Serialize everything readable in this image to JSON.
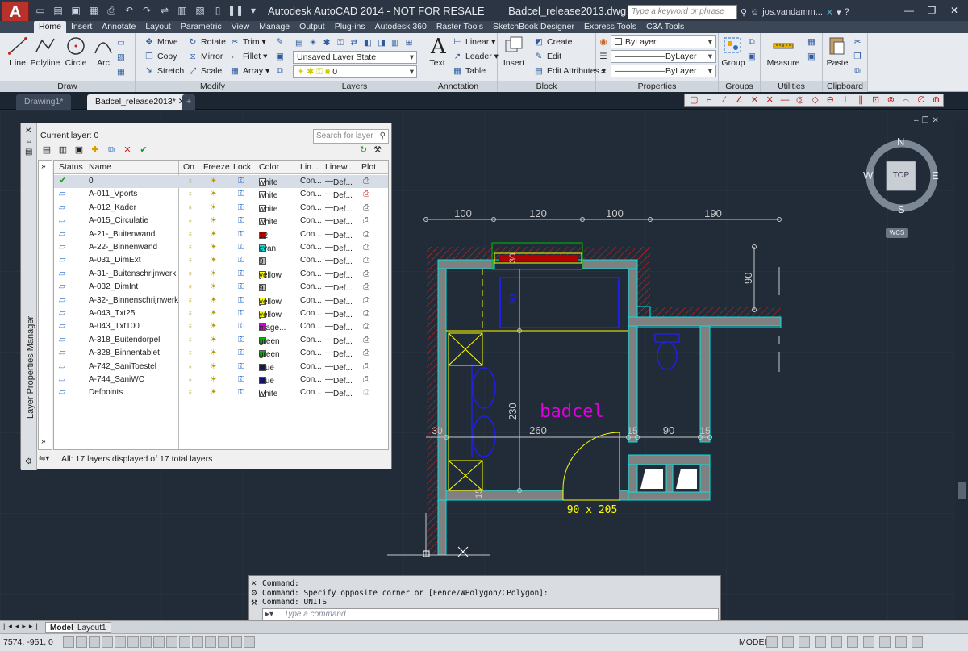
{
  "app": {
    "logo": "A",
    "title": "Autodesk AutoCAD 2014 - NOT FOR RESALE",
    "filename": "Badcel_release2013.dwg",
    "search_placeholder": "Type a keyword or phrase",
    "user": "jos.vandamm..."
  },
  "ribbon_tabs": [
    "Home",
    "Insert",
    "Annotate",
    "Layout",
    "Parametric",
    "View",
    "Manage",
    "Output",
    "Plug-ins",
    "Autodesk 360",
    "Raster Tools",
    "SketchBook Designer",
    "Express Tools",
    "C3A Tools"
  ],
  "ribbon": {
    "draw": {
      "title": "Draw",
      "line": "Line",
      "polyline": "Polyline",
      "circle": "Circle",
      "arc": "Arc"
    },
    "modify": {
      "title": "Modify",
      "move": "Move",
      "rotate": "Rotate",
      "trim": "Trim",
      "copy": "Copy",
      "mirror": "Mirror",
      "fillet": "Fillet",
      "stretch": "Stretch",
      "scale": "Scale",
      "array": "Array"
    },
    "layers": {
      "title": "Layers",
      "state": "Unsaved Layer State",
      "current": "0"
    },
    "annotation": {
      "title": "Annotation",
      "text": "Text",
      "linear": "Linear",
      "leader": "Leader",
      "table": "Table"
    },
    "block": {
      "title": "Block",
      "insert": "Insert",
      "create": "Create",
      "edit": "Edit",
      "edit_attributes": "Edit Attributes"
    },
    "properties": {
      "title": "Properties",
      "color": "ByLayer",
      "linetype": "ByLayer",
      "lineweight": "ByLayer"
    },
    "groups": {
      "title": "Groups",
      "group": "Group"
    },
    "utilities": {
      "title": "Utilities",
      "measure": "Measure"
    },
    "clipboard": {
      "title": "Clipboard",
      "paste": "Paste"
    }
  },
  "doc_tabs": [
    "Drawing1*",
    "Badcel_release2013*"
  ],
  "layer_manager": {
    "title": "Layer Properties Manager",
    "current_layer": "Current layer: 0",
    "search_placeholder": "Search for layer",
    "columns": [
      "Status",
      "Name",
      "On",
      "Freeze",
      "Lock",
      "Color",
      "Lin...",
      "Linew...",
      "Plot"
    ],
    "status_text": "All: 17 layers displayed of 17 total layers",
    "layers": [
      {
        "name": "0",
        "color": "white",
        "swatch": "#ffffff",
        "linetype": "Con...",
        "lineweight": "Def..."
      },
      {
        "name": "A-011_Vports",
        "color": "white",
        "swatch": "#ffffff",
        "linetype": "Con...",
        "lineweight": "Def..."
      },
      {
        "name": "A-012_Kader",
        "color": "white",
        "swatch": "#ffffff",
        "linetype": "Con...",
        "lineweight": "Def..."
      },
      {
        "name": "A-015_Circulatie",
        "color": "white",
        "swatch": "#ffffff",
        "linetype": "Con...",
        "lineweight": "Def..."
      },
      {
        "name": "A-21-_Buitenwand",
        "color": "12",
        "swatch": "#b00000",
        "linetype": "Con...",
        "lineweight": "Def..."
      },
      {
        "name": "A-22-_Binnenwand",
        "color": "cyan",
        "swatch": "#00e5e5",
        "linetype": "Con...",
        "lineweight": "Def..."
      },
      {
        "name": "A-031_DimExt",
        "color": "9",
        "swatch": "#c0c0c0",
        "linetype": "Con...",
        "lineweight": "Def..."
      },
      {
        "name": "A-31-_Buitenschrijnwerk",
        "color": "yellow",
        "swatch": "#ffff00",
        "linetype": "Con...",
        "lineweight": "Def..."
      },
      {
        "name": "A-032_DimInt",
        "color": "9",
        "swatch": "#c0c0c0",
        "linetype": "Con...",
        "lineweight": "Def..."
      },
      {
        "name": "A-32-_Binnenschrijnwerk",
        "color": "yellow",
        "swatch": "#ffff00",
        "linetype": "Con...",
        "lineweight": "Def..."
      },
      {
        "name": "A-043_Txt25",
        "color": "yellow",
        "swatch": "#ffff00",
        "linetype": "Con...",
        "lineweight": "Def..."
      },
      {
        "name": "A-043_Txt100",
        "color": "mage...",
        "swatch": "#e000e0",
        "linetype": "Con...",
        "lineweight": "Def..."
      },
      {
        "name": "A-318_Buitendorpel",
        "color": "green",
        "swatch": "#00c000",
        "linetype": "Con...",
        "lineweight": "Def..."
      },
      {
        "name": "A-328_Binnentablet",
        "color": "green",
        "swatch": "#00c000",
        "linetype": "Con...",
        "lineweight": "Def..."
      },
      {
        "name": "A-742_SaniToestel",
        "color": "blue",
        "swatch": "#0000e0",
        "linetype": "Con...",
        "lineweight": "Def..."
      },
      {
        "name": "A-744_SaniWC",
        "color": "blue",
        "swatch": "#0000e0",
        "linetype": "Con...",
        "lineweight": "Def..."
      },
      {
        "name": "Defpoints",
        "color": "white",
        "swatch": "#ffffff",
        "linetype": "Con...",
        "lineweight": "Def..."
      }
    ]
  },
  "drawing": {
    "dims_top": [
      "100",
      "120",
      "100",
      "190"
    ],
    "dim_90_right": "90",
    "dim_30_window": "30",
    "dim_90_bath": "90",
    "dim_230": "230",
    "dim_30_left": "30",
    "dim_260": "260",
    "dim_15a": "15",
    "dim_90_mid": "90",
    "dim_15b": "15",
    "dim_15_low": "15",
    "room_label": "badcel",
    "door_label": "90 x 205"
  },
  "viewcube": {
    "n": "N",
    "s": "S",
    "e": "E",
    "w": "W",
    "face": "TOP",
    "wcs": "WCS"
  },
  "command": {
    "lines": [
      "Command:",
      "Command: Specify opposite corner or [Fence/WPolygon/CPolygon]:",
      "Command: UNITS"
    ],
    "placeholder": "Type a command"
  },
  "layout_tabs": [
    "Model",
    "Layout1"
  ],
  "status": {
    "coords": "7574, -951, 0",
    "model": "MODEL"
  }
}
